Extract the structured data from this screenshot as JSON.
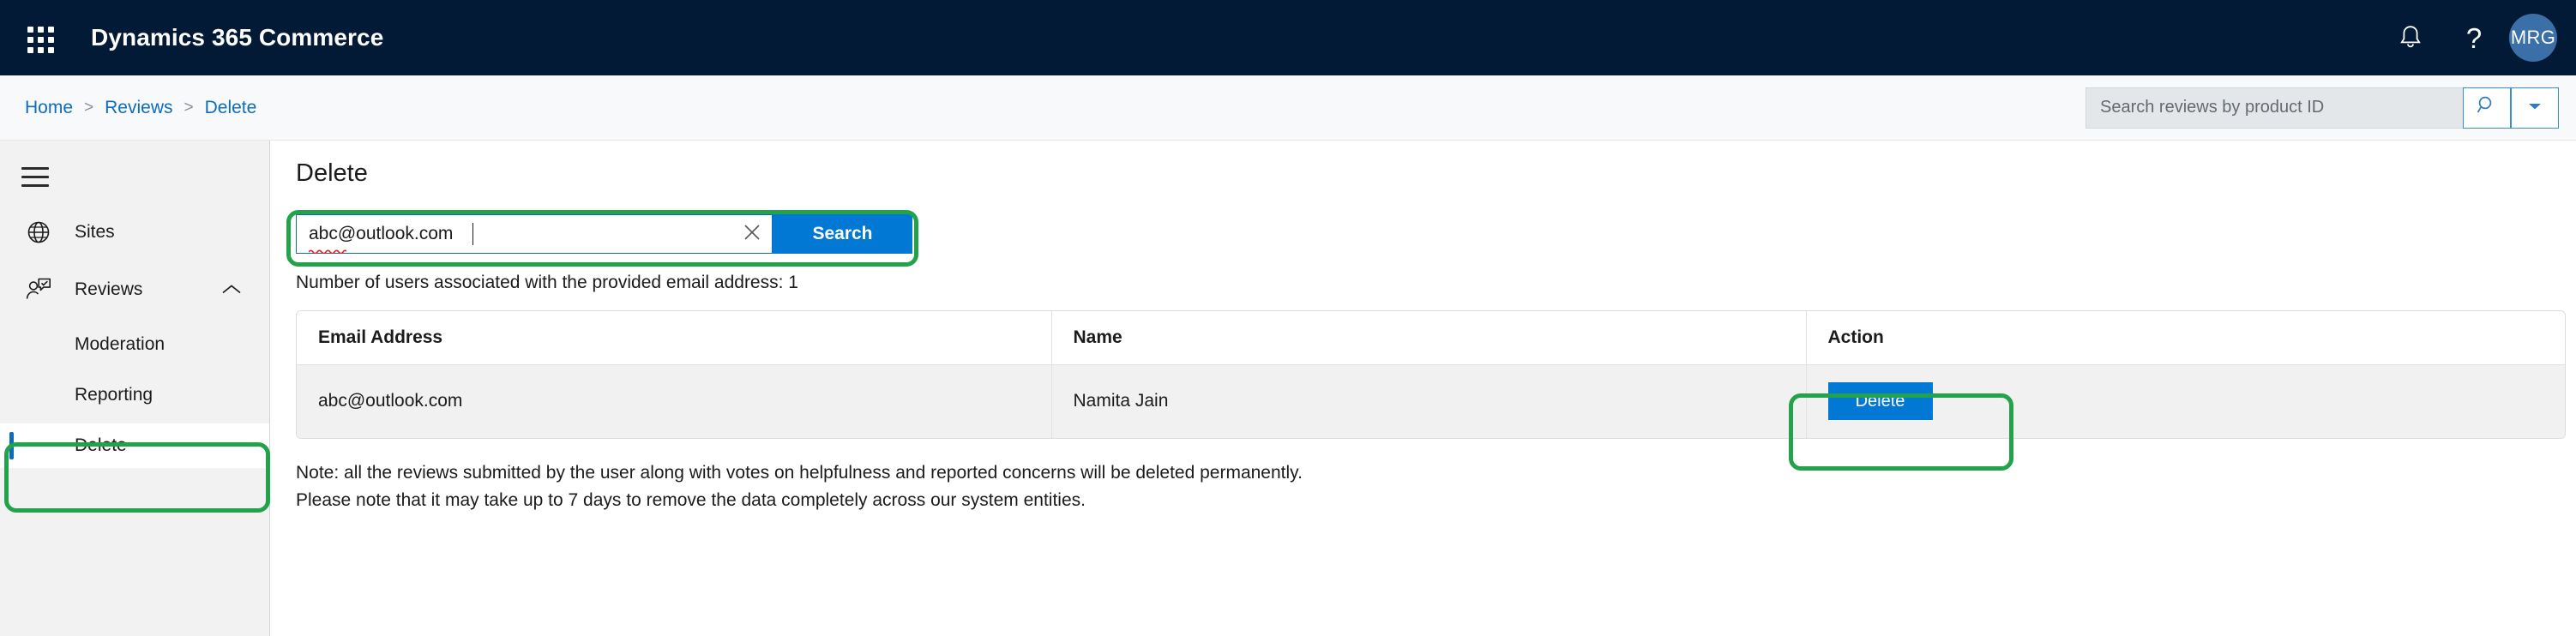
{
  "topnav": {
    "waffle_icon": "waffle-grid-icon",
    "app_title": "Dynamics 365 Commerce",
    "notification_icon": "bell-icon",
    "help_label": "?",
    "avatar_initials": "MRG",
    "background_color": "#031A36",
    "avatar_color": "#3B6FA8"
  },
  "breadcrumb": {
    "items": [
      {
        "label": "Home"
      },
      {
        "label": "Reviews"
      },
      {
        "label": "Delete"
      }
    ],
    "separator": ">",
    "link_color": "#0F6CBD"
  },
  "topsearch": {
    "placeholder": "Search reviews by product ID",
    "value": "",
    "search_icon": "magnifier-icon",
    "dropdown_icon": "chevron-down-icon"
  },
  "sidebar": {
    "hamburger_icon": "hamburger-menu-icon",
    "items": [
      {
        "label": "Sites",
        "icon": "globe-icon"
      },
      {
        "label": "Reviews",
        "icon": "person-review-icon",
        "chevron": "chevron-up-icon"
      }
    ],
    "subitems": [
      {
        "label": "Moderation",
        "selected": false
      },
      {
        "label": "Reporting",
        "selected": false
      },
      {
        "label": "Delete",
        "selected": true
      }
    ],
    "selected_indicator_color": "#0F6CBD"
  },
  "main": {
    "page_title": "Delete",
    "search": {
      "value": "abc@outlook.com",
      "clear_icon": "close-x-icon",
      "button_label": "Search",
      "button_color": "#0078D4"
    },
    "count_text": "Number of users associated with the provided email address: 1",
    "table": {
      "columns": [
        "Email Address",
        "Name",
        "Action"
      ],
      "rows": [
        {
          "email": "abc@outlook.com",
          "name": "Namita Jain",
          "action_label": "Delete"
        }
      ]
    },
    "note": "Note: all the reviews submitted by the user along with votes on helpfulness and reported concerns will be deleted permanently. Please note that it may take up to 7 days to remove the data completely across our system entities."
  },
  "annotations": {
    "color": "#22A24B",
    "regions": [
      "sidebar-delete-item",
      "email-search-box",
      "row-delete-button"
    ]
  }
}
